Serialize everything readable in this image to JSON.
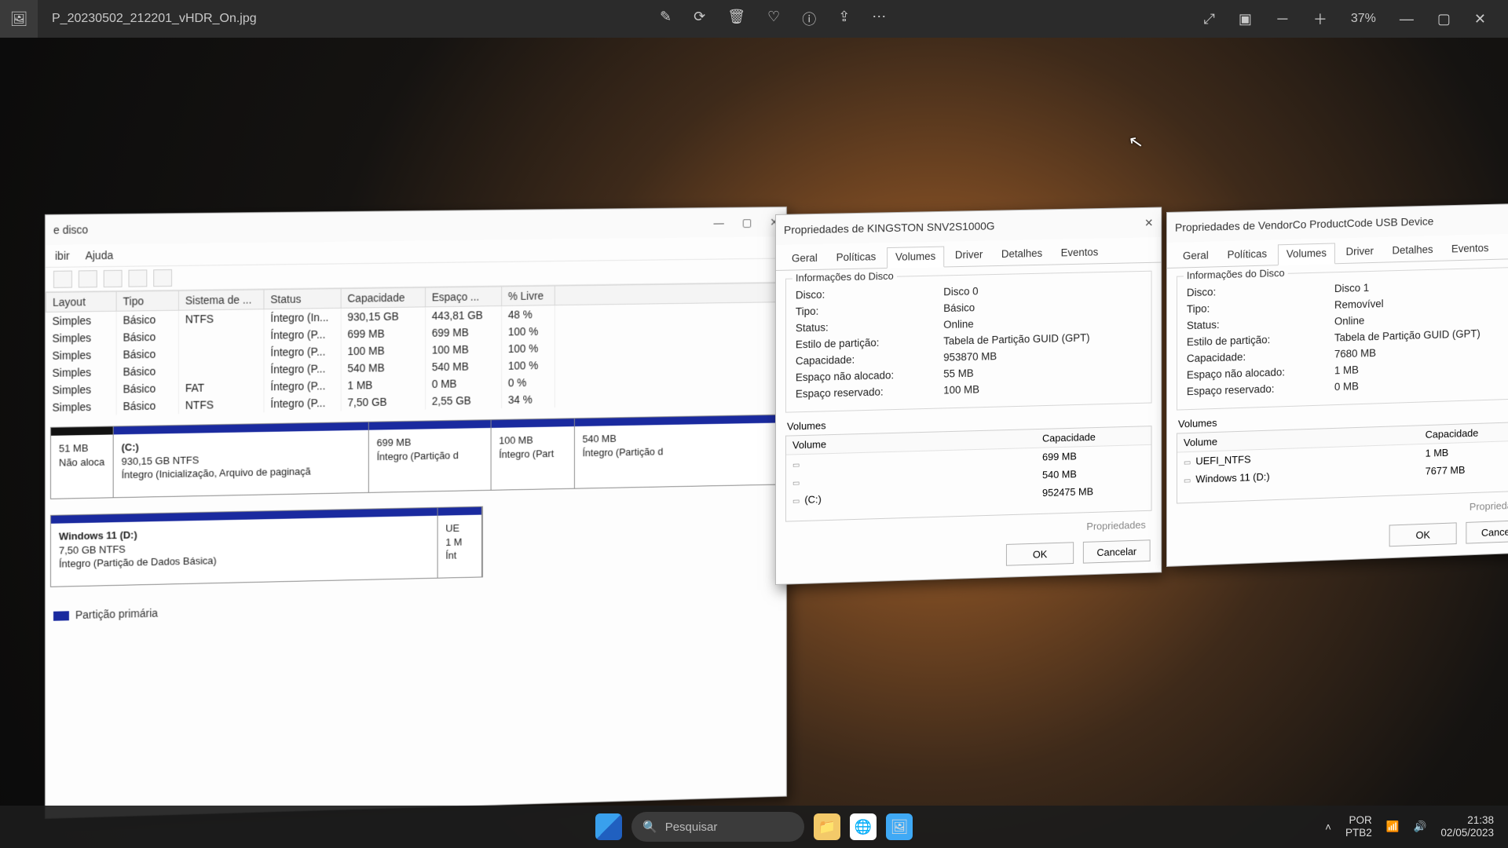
{
  "viewer": {
    "filename": "P_20230502_212201_vHDR_On.jpg",
    "zoom": "37%",
    "icons": {
      "edit": "edit",
      "rotate": "rotate",
      "delete": "delete",
      "heart": "favorite",
      "info": "info",
      "share": "share",
      "more": "more",
      "fullscreen": "fullscreen",
      "film": "filmstrip",
      "zoomout": "zoom-out",
      "zoomin": "zoom-in",
      "min": "minimize",
      "max": "maximize",
      "close": "close"
    }
  },
  "dm": {
    "title_suffix": "e disco",
    "menu": {
      "view": "ibir",
      "help": "Ajuda"
    },
    "columns": {
      "layout": "Layout",
      "type": "Tipo",
      "fs": "Sistema de ...",
      "status": "Status",
      "cap": "Capacidade",
      "free": "Espaço ...",
      "pct": "% Livre"
    },
    "rows": [
      {
        "layout": "Simples",
        "type": "Básico",
        "fs": "NTFS",
        "status": "Íntegro (In...",
        "cap": "930,15 GB",
        "free": "443,81 GB",
        "pct": "48 %"
      },
      {
        "layout": "Simples",
        "type": "Básico",
        "fs": "",
        "status": "Íntegro (P...",
        "cap": "699 MB",
        "free": "699 MB",
        "pct": "100 %"
      },
      {
        "layout": "Simples",
        "type": "Básico",
        "fs": "",
        "status": "Íntegro (P...",
        "cap": "100 MB",
        "free": "100 MB",
        "pct": "100 %"
      },
      {
        "layout": "Simples",
        "type": "Básico",
        "fs": "",
        "status": "Íntegro (P...",
        "cap": "540 MB",
        "free": "540 MB",
        "pct": "100 %"
      },
      {
        "layout": "Simples",
        "type": "Básico",
        "fs": "FAT",
        "status": "Íntegro (P...",
        "cap": "1 MB",
        "free": "0 MB",
        "pct": "0 %"
      },
      {
        "layout": "Simples",
        "type": "Básico",
        "fs": "NTFS",
        "status": "Íntegro (P...",
        "cap": "7,50 GB",
        "free": "2,55 GB",
        "pct": "34 %"
      }
    ],
    "map0": {
      "seg0": {
        "l1": "51 MB",
        "l2": "Não aloca"
      },
      "seg1": {
        "l0": "(C:)",
        "l1": "930,15 GB NTFS",
        "l2": "Íntegro (Inicialização, Arquivo de paginaçã"
      },
      "seg2": {
        "l1": "699 MB",
        "l2": "Íntegro (Partição d"
      },
      "seg3": {
        "l1": "100 MB",
        "l2": "Íntegro (Part"
      },
      "seg4": {
        "l1": "540 MB",
        "l2": "Íntegro (Partição d"
      }
    },
    "map1": {
      "seg0": {
        "l0": "Windows 11  (D:)",
        "l1": "7,50 GB NTFS",
        "l2": "Íntegro (Partição de Dados Básica)"
      },
      "seg1": {
        "l0": "UE",
        "l1": "1 M",
        "l2": "Ínt"
      }
    },
    "legend": "Partição primária"
  },
  "dlg1": {
    "title": "Propriedades de KINGSTON SNV2S1000G",
    "tabs": {
      "geral": "Geral",
      "pol": "Políticas",
      "vol": "Volumes",
      "drv": "Driver",
      "det": "Detalhes",
      "ev": "Eventos"
    },
    "group": "Informações do Disco",
    "info": {
      "disk_k": "Disco:",
      "disk_v": "Disco 0",
      "type_k": "Tipo:",
      "type_v": "Básico",
      "stat_k": "Status:",
      "stat_v": "Online",
      "part_k": "Estilo de partição:",
      "part_v": "Tabela de Partição GUID (GPT)",
      "cap_k": "Capacidade:",
      "cap_v": "953870 MB",
      "una_k": "Espaço não alocado:",
      "una_v": "55 MB",
      "res_k": "Espaço reservado:",
      "res_v": "100 MB"
    },
    "vol_label": "Volumes",
    "vol_head": {
      "c1": "Volume",
      "c2": "Capacidade"
    },
    "vols": [
      {
        "name": "",
        "cap": "699 MB"
      },
      {
        "name": "",
        "cap": "540 MB"
      },
      {
        "name": "(C:)",
        "cap": "952475 MB"
      }
    ],
    "props": "Propriedades",
    "ok": "OK",
    "cancel": "Cancelar"
  },
  "dlg2": {
    "title": "Propriedades de VendorCo ProductCode USB Device",
    "tabs": {
      "geral": "Geral",
      "pol": "Políticas",
      "vol": "Volumes",
      "drv": "Driver",
      "det": "Detalhes",
      "ev": "Eventos"
    },
    "group": "Informações do Disco",
    "info": {
      "disk_k": "Disco:",
      "disk_v": "Disco 1",
      "type_k": "Tipo:",
      "type_v": "Removível",
      "stat_k": "Status:",
      "stat_v": "Online",
      "part_k": "Estilo de partição:",
      "part_v": "Tabela de Partição GUID (GPT)",
      "cap_k": "Capacidade:",
      "cap_v": "7680 MB",
      "una_k": "Espaço não alocado:",
      "una_v": "1 MB",
      "res_k": "Espaço reservado:",
      "res_v": "0 MB"
    },
    "vol_label": "Volumes",
    "vol_head": {
      "c1": "Volume",
      "c2": "Capacidade"
    },
    "vols": [
      {
        "name": "UEFI_NTFS",
        "cap": "1 MB"
      },
      {
        "name": "Windows 11 (D:)",
        "cap": "7677 MB"
      }
    ],
    "props": "Propriedades",
    "ok": "OK",
    "cancel": "Cancela"
  },
  "taskbar": {
    "search": "Pesquisar",
    "lang1": "POR",
    "lang2": "PTB2",
    "time": "21:38",
    "date": "02/05/2023"
  }
}
